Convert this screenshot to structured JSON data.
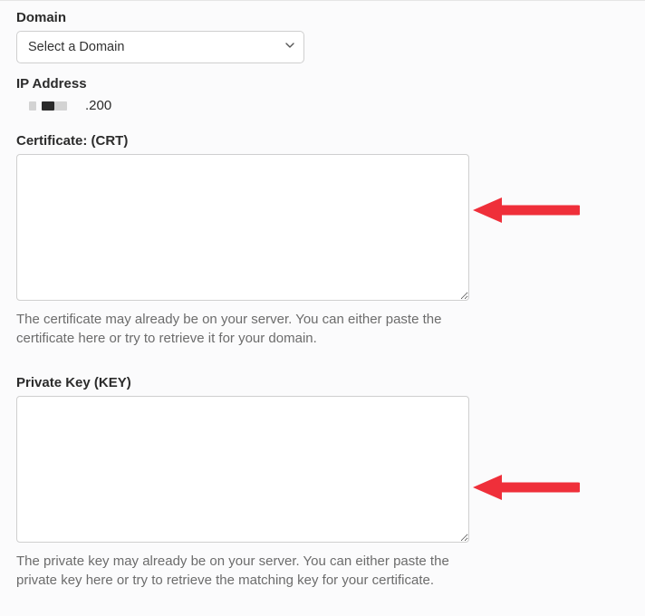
{
  "domain": {
    "label": "Domain",
    "selected": "Select a Domain"
  },
  "ip": {
    "label": "IP Address",
    "value": ".200"
  },
  "crt": {
    "label": "Certificate: (CRT)",
    "value": "",
    "helptext": "The certificate may already be on your server. You can either paste the certificate here or try to retrieve it for your domain."
  },
  "key": {
    "label": "Private Key (KEY)",
    "value": "",
    "helptext": "The private key may already be on your server. You can either paste the private key here or try to retrieve the matching key for your certificate."
  }
}
